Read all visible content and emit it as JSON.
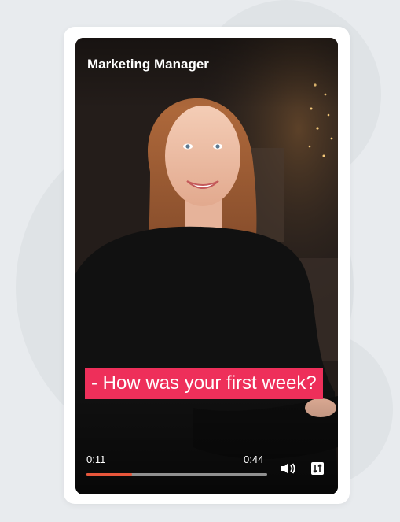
{
  "video": {
    "title": "Marketing Manager",
    "subtitle": "- How was your first week?",
    "current_time": "0:11",
    "duration": "0:44",
    "progress": 0.25
  },
  "controls": {
    "volume_icon": "volume-icon",
    "captions_icon": "captions-icon"
  },
  "colors": {
    "subtitle_bg": "#ee2f5a",
    "progress_fill": "#e8563b",
    "page_bg": "#e8ebee"
  }
}
